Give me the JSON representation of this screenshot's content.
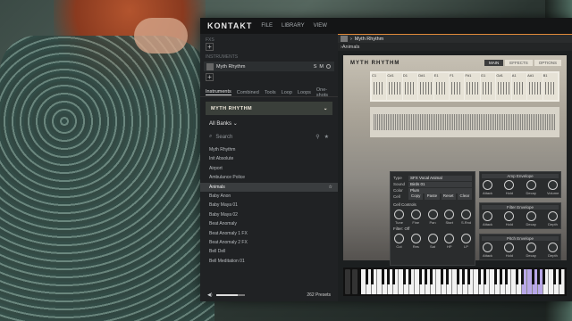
{
  "app": {
    "logo": "KONTAKT",
    "menu": [
      "FILE",
      "LIBRARY",
      "VIEW"
    ]
  },
  "left": {
    "fx_label": "FXS",
    "instruments_label": "INSTRUMENTS",
    "instrument_name": "Myth Rhythm",
    "instrument_controls": [
      "S",
      "M"
    ],
    "tabs": [
      "Instruments",
      "Combined",
      "Tools",
      "Loop",
      "Loops",
      "One-shots"
    ],
    "active_tab": "Instruments",
    "banner": "MYTH RHYTHM",
    "banks": "All Banks",
    "search_placeholder": "Search",
    "list": [
      "Myth Rhythm",
      "Init Absolute",
      "Airport",
      "Ambulance Police",
      "Animals",
      "Baby Anon",
      "Baby Maya 01",
      "Baby Maya 02",
      "Beat Anomaly",
      "Beat Anomaly 1 FX",
      "Beat Anomaly 2 FX",
      "Bell Dell",
      "Bell Meditation 01"
    ],
    "selected": "Animals",
    "volume_level": 0.75,
    "presets_count": "262 Presets"
  },
  "right": {
    "header_title": "Myth Rhythm",
    "sub_title": "Animals",
    "instrument_title": "MYTH RHYTHM",
    "inst_tabs": [
      "MAIN",
      "EFFECTS",
      "OPTIONS"
    ],
    "active_inst_tab": "MAIN",
    "sample_slots": [
      "C1",
      "C#1",
      "D1",
      "D#1",
      "E1",
      "F1",
      "F#1",
      "G1",
      "G#1",
      "A1",
      "A#1",
      "B1"
    ],
    "panel": {
      "type_label": "Type",
      "type_value": "SFX Vocal Animal",
      "sound_label": "Sound",
      "sound_value": "Birds 01",
      "color_label": "Color",
      "color_value": "Plum",
      "cell_label": "Cell",
      "buttons": [
        "Copy",
        "Paste",
        "Reset",
        "Clear"
      ],
      "controls_label": "Cell Controls",
      "knobs1": [
        "Tune",
        "Fine",
        "Pan",
        "Start",
        "S.Rnd"
      ],
      "filter_label": "Filter: Off",
      "knobs2": [
        "Cut",
        "Res",
        "Sat",
        "HP",
        "LP"
      ]
    },
    "envs": [
      {
        "title": "Amp Envelope",
        "knobs": [
          "Attack",
          "Hold",
          "Decay",
          "Volume"
        ]
      },
      {
        "title": "Filter Envelope",
        "knobs": [
          "Attack",
          "Hold",
          "Decay",
          "Depth"
        ]
      },
      {
        "title": "Pitch Envelope",
        "knobs": [
          "Attack",
          "Hold",
          "Decay",
          "Depth"
        ]
      }
    ]
  }
}
